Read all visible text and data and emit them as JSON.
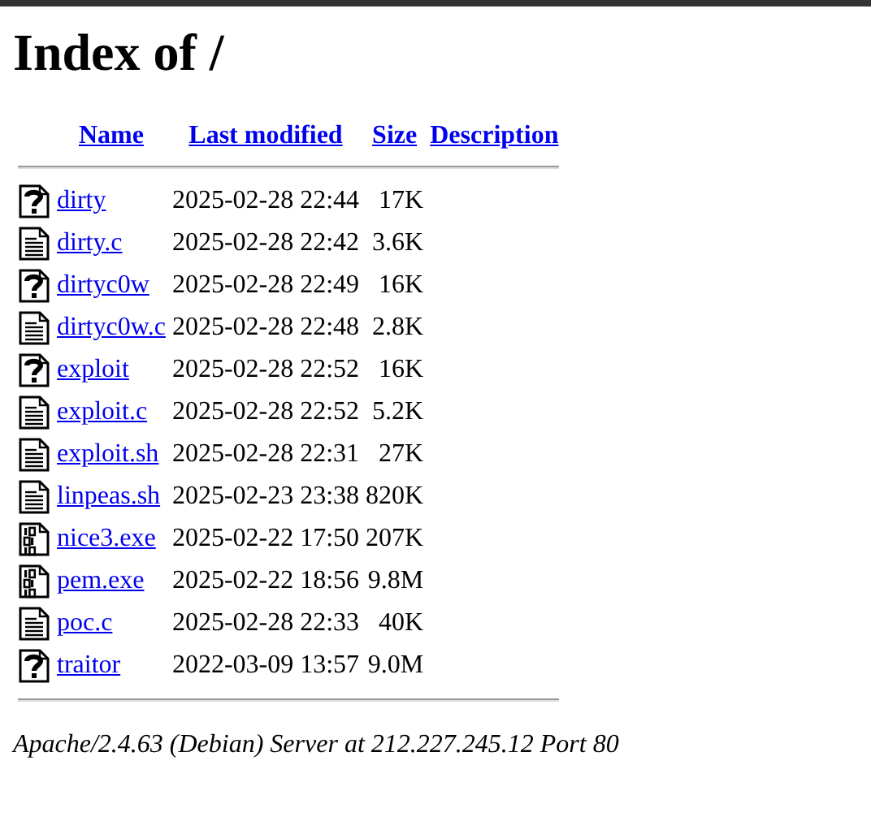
{
  "title": "Index of /",
  "columns": [
    "Name",
    "Last modified",
    "Size",
    "Description"
  ],
  "rows": [
    {
      "kind": "unknown",
      "name": "dirty",
      "modified": "2025-02-28 22:44",
      "size": "17K"
    },
    {
      "kind": "text",
      "name": "dirty.c",
      "modified": "2025-02-28 22:42",
      "size": "3.6K"
    },
    {
      "kind": "unknown",
      "name": "dirtyc0w",
      "modified": "2025-02-28 22:49",
      "size": "16K"
    },
    {
      "kind": "text",
      "name": "dirtyc0w.c",
      "modified": "2025-02-28 22:48",
      "size": "2.8K"
    },
    {
      "kind": "unknown",
      "name": "exploit",
      "modified": "2025-02-28 22:52",
      "size": "16K"
    },
    {
      "kind": "text",
      "name": "exploit.c",
      "modified": "2025-02-28 22:52",
      "size": "5.2K"
    },
    {
      "kind": "text",
      "name": "exploit.sh",
      "modified": "2025-02-28 22:31",
      "size": "27K"
    },
    {
      "kind": "text",
      "name": "linpeas.sh",
      "modified": "2025-02-23 23:38",
      "size": "820K"
    },
    {
      "kind": "binary",
      "name": "nice3.exe",
      "modified": "2025-02-22 17:50",
      "size": "207K"
    },
    {
      "kind": "binary",
      "name": "pem.exe",
      "modified": "2025-02-22 18:56",
      "size": "9.8M"
    },
    {
      "kind": "text",
      "name": "poc.c",
      "modified": "2025-02-28 22:33",
      "size": "40K"
    },
    {
      "kind": "unknown",
      "name": "traitor",
      "modified": "2022-03-09 13:57",
      "size": "9.0M"
    }
  ],
  "footer": "Apache/2.4.63 (Debian) Server at 212.227.245.12 Port 80"
}
